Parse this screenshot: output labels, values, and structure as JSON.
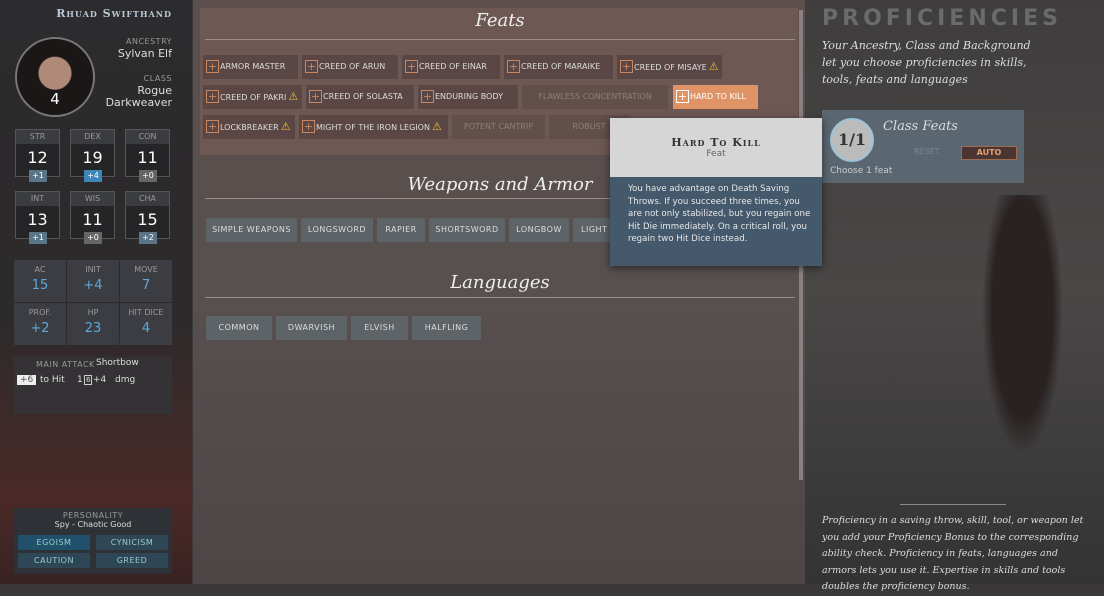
{
  "character": {
    "name": "Rhuad Swifthand",
    "level": "4",
    "ancestry_label": "ANCESTRY",
    "ancestry": "Sylvan Elf",
    "class_label": "CLASS",
    "class": "Rogue",
    "subclass": "Darkweaver"
  },
  "abilities": [
    {
      "label": "STR",
      "score": "12",
      "mod": "+1"
    },
    {
      "label": "DEX",
      "score": "19",
      "mod": "+4"
    },
    {
      "label": "CON",
      "score": "11",
      "mod": "+0"
    },
    {
      "label": "INT",
      "score": "13",
      "mod": "+1"
    },
    {
      "label": "WIS",
      "score": "11",
      "mod": "+0"
    },
    {
      "label": "CHA",
      "score": "15",
      "mod": "+2"
    }
  ],
  "derived": [
    {
      "label": "AC",
      "value": "15"
    },
    {
      "label": "INIT",
      "value": "+4"
    },
    {
      "label": "MOVE",
      "value": "7"
    },
    {
      "label": "PROF.",
      "value": "+2"
    },
    {
      "label": "HP",
      "value": "23"
    },
    {
      "label": "HIT DICE",
      "value": "4"
    }
  ],
  "attack": {
    "label": "MAIN ATTACK",
    "weapon": "Shortbow",
    "to_hit": "+6",
    "to_hit_label": "to Hit",
    "damage_count": "1",
    "die": "6",
    "damage_bonus": "+4",
    "damage_label": "dmg"
  },
  "personality": {
    "label": "PERSONALITY",
    "value": "Spy - Chaotic Good",
    "traits": [
      "EGOISM",
      "CYNICISM",
      "CAUTION",
      "GREED"
    ]
  },
  "feats": {
    "title": "Feats",
    "items": [
      "ARMOR MASTER",
      "CREED OF ARUN",
      "CREED OF EINAR",
      "CREED OF MARAIKE",
      "CREED OF MISAYE",
      "CREED OF PAKRI",
      "CREED OF SOLASTA",
      "ENDURING BODY",
      "FLAWLESS CONCENTRATION",
      "HARD TO KILL",
      "LOCKBREAKER",
      "MIGHT OF THE IRON LEGION",
      "POTENT CANTRIP",
      "ROBUST"
    ]
  },
  "weapons": {
    "title": "Weapons and Armor",
    "items": [
      "SIMPLE WEAPONS",
      "LONGSWORD",
      "RAPIER",
      "SHORTSWORD",
      "LONGBOW",
      "LIGHT A"
    ]
  },
  "languages": {
    "title": "Languages",
    "items": [
      "COMMON",
      "DWARVISH",
      "ELVISH",
      "HALFLING"
    ]
  },
  "tooltip": {
    "title": "Hard To Kill",
    "subtitle": "Feat",
    "body": "You have advantage on Death Saving Throws. If you succeed three times, you are not only stabilized, but you regain one Hit Die immediately. On a critical roll, you regain two Hit Dice instead."
  },
  "right": {
    "title": "PROFICIENCIES",
    "intro": "Your Ancestry, Class and Background let you choose proficiencies in skills, tools, feats and languages",
    "footer": "Proficiency in a saving throw, skill, tool, or weapon let you add your Proficiency Bonus to the corresponding ability check. Proficiency in feats, languages and armors lets you use it. Expertise in skills and tools doubles the proficiency bonus."
  },
  "class_feats": {
    "counter": "1/1",
    "title": "Class Feats",
    "reset": "RESET",
    "auto": "AUTO",
    "hint": "Choose 1 feat"
  },
  "colors": {
    "accent": "#e09466",
    "blue": "#5aa8dc"
  }
}
